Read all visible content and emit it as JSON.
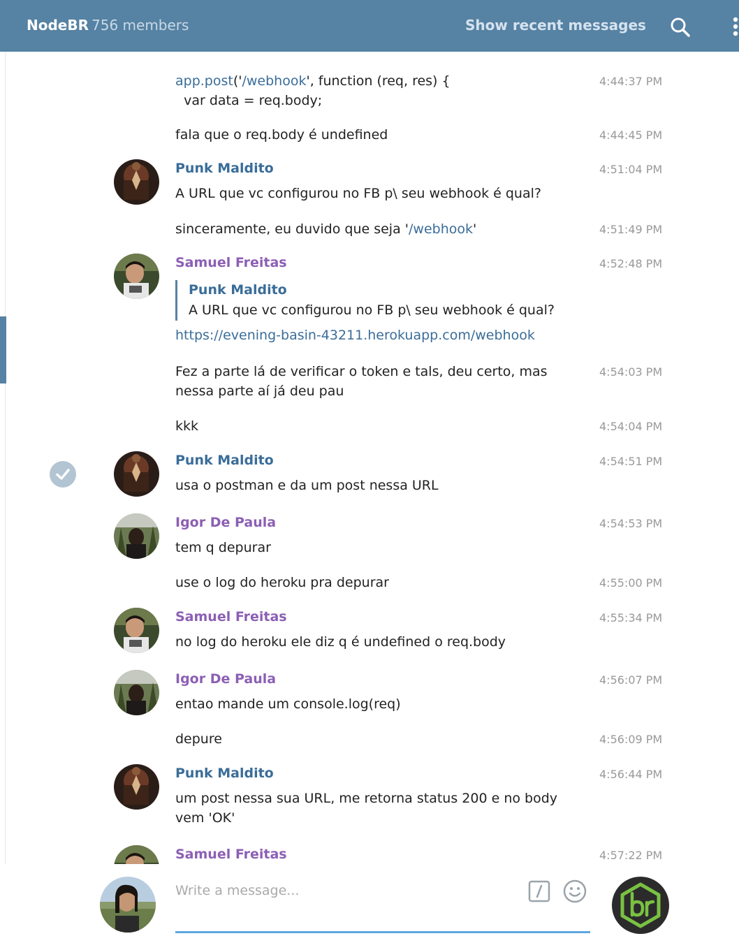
{
  "header": {
    "chat_title": "NodeBR",
    "members": "756 members",
    "recent_label": "Show recent messages",
    "search_icon": "search-icon",
    "more_icon": "vertical-dots-icon",
    "bg_color": "#5682a3"
  },
  "colors": {
    "name_blue": "#3a6d99",
    "name_purple": "#8c5fb4",
    "link": "#3a6d99",
    "time": "#999999"
  },
  "messages": [
    {
      "lines": [
        [
          "app.post",
          "('",
          "/webhook",
          "', function (req, res) {"
        ],
        "  var data = req.body;"
      ],
      "time": "4:44:37 PM"
    },
    {
      "text": "fala que o req.body é undefined",
      "time": "4:44:45 PM"
    },
    {
      "author": "Punk Maldito",
      "text": "A URL que vc configurou no FB p\\ seu webhook é qual?",
      "time": "4:51:04 PM"
    },
    {
      "text_parts": [
        "sinceramente, eu duvido que seja '",
        "/webhook",
        "'"
      ],
      "time": "4:51:49 PM"
    },
    {
      "author": "Samuel Freitas",
      "quote_author": "Punk Maldito",
      "quote_text": "A URL que vc configurou no FB p\\ seu webhook é qual?",
      "link": "https://evening-basin-43211.herokuapp.com/webhook",
      "time": "4:52:48 PM"
    },
    {
      "text": "Fez a parte lá de verificar o token e tals, deu certo, mas nessa parte aí já deu pau",
      "time": "4:54:03 PM"
    },
    {
      "text": "kkk",
      "time": "4:54:04 PM"
    },
    {
      "author": "Punk Maldito",
      "text": "usa o postman e da um post nessa URL",
      "time": "4:54:51 PM"
    },
    {
      "author": "Igor De Paula",
      "text": "tem q depurar",
      "time": "4:54:53 PM"
    },
    {
      "text": "use o log do heroku pra depurar",
      "time": "4:55:00 PM"
    },
    {
      "author": "Samuel Freitas",
      "text": "no log do heroku ele diz q é undefined o req.body",
      "time": "4:55:34 PM"
    },
    {
      "author": "Igor De Paula",
      "text": "entao mande um console.log(req)",
      "time": "4:56:07 PM"
    },
    {
      "text": "depure",
      "time": "4:56:09 PM"
    },
    {
      "author": "Punk Maldito",
      "text": "um post nessa sua URL, me retorna status 200 e no body vem 'OK'",
      "time": "4:56:44 PM"
    },
    {
      "author": "Samuel Freitas",
      "time": "4:57:22 PM"
    }
  ],
  "composer": {
    "placeholder": "Write a message...",
    "command_icon": "slash-command-icon",
    "emoji_icon": "smiley-icon",
    "brand_icon": "br-hexagon-icon",
    "underline_color": "#5da8e0"
  }
}
